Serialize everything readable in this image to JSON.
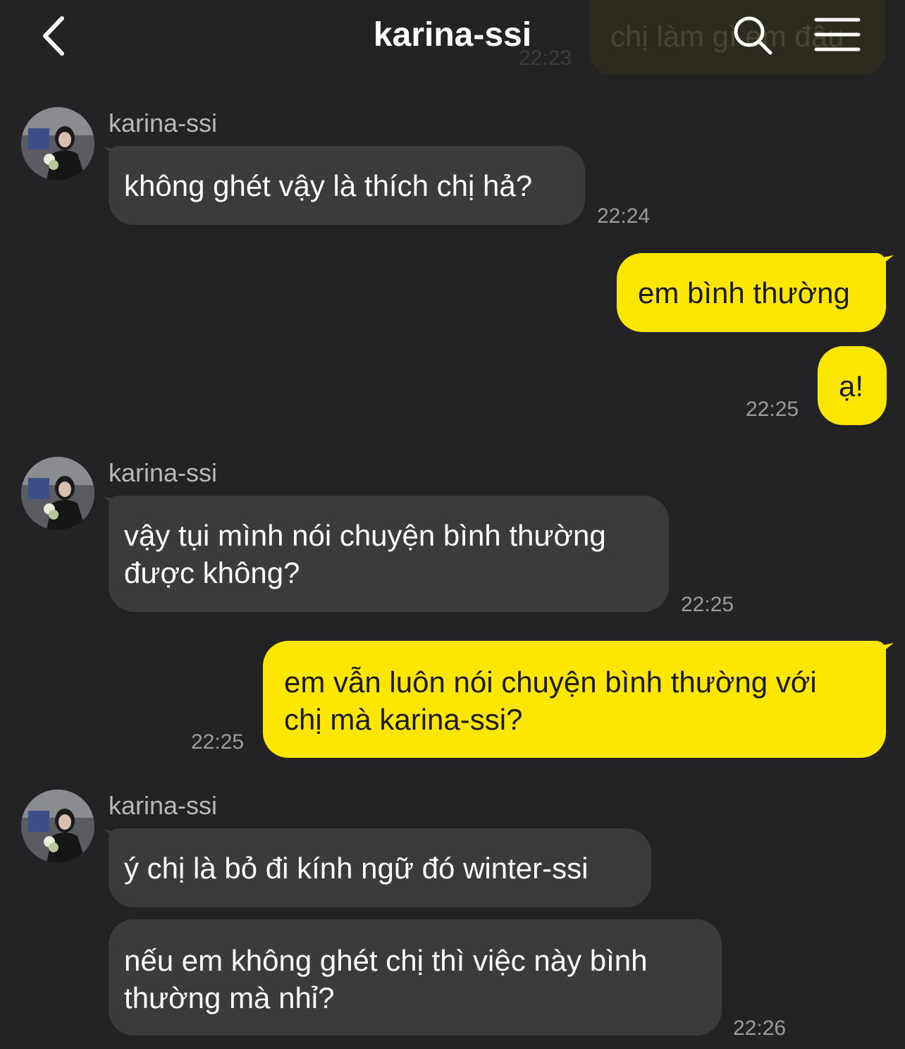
{
  "header": {
    "title": "karina-ssi"
  },
  "scrolled_message": {
    "text": "chị làm gì em đâu",
    "time": "22:23"
  },
  "messages": [
    {
      "sender": "karina-ssi",
      "text": "không ghét vậy là thích chị hả?",
      "time": "22:24"
    },
    {
      "text": "em bình thường"
    },
    {
      "text": "ạ!",
      "time": "22:25"
    },
    {
      "sender": "karina-ssi",
      "lines": [
        "vậy tụi mình nói chuyện bình thường",
        "được không?"
      ],
      "time": "22:25"
    },
    {
      "lines": [
        "em vẫn luôn nói chuyện bình thường với",
        "chị mà karina-ssi?"
      ],
      "time": "22:25"
    },
    {
      "sender": "karina-ssi",
      "text": "ý chị là bỏ đi kính ngữ đó winter-ssi"
    },
    {
      "lines": [
        "nếu em không ghét chị thì việc này bình",
        "thường mà nhỉ?"
      ],
      "time": "22:26"
    }
  ],
  "colors": {
    "background": "#232325",
    "incoming_bubble": "#3b3b3e",
    "outgoing_bubble": "#fde600",
    "timestamp": "#9b9ba0"
  },
  "icons": [
    "back-chevron-icon",
    "search-icon",
    "menu-icon",
    "avatar"
  ]
}
